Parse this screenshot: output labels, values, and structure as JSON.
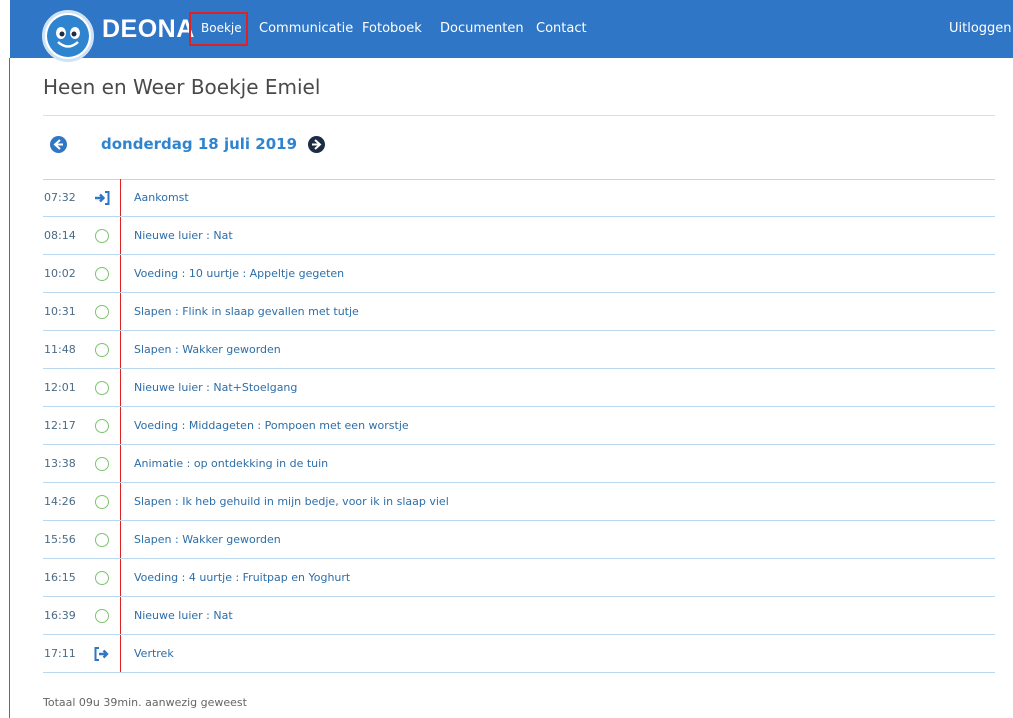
{
  "app": {
    "brand": "DEONA",
    "logo_icon": "smiley-face-icon"
  },
  "nav": {
    "items": [
      {
        "label": "Boekje"
      },
      {
        "label": "Communicatie"
      },
      {
        "label": "Fotoboek"
      },
      {
        "label": "Documenten"
      },
      {
        "label": "Contact"
      }
    ],
    "logout": "Uitloggen"
  },
  "page": {
    "title": "Heen en Weer Boekje Emiel",
    "date": "donderdag 18 juli 2019",
    "prev_icon": "arrow-left-icon",
    "next_icon": "arrow-right-icon"
  },
  "entries": [
    {
      "time": "07:32",
      "icon": "sign-in-icon",
      "text": "Aankomst"
    },
    {
      "time": "08:14",
      "icon": "circle-icon",
      "text": "Nieuwe luier : Nat"
    },
    {
      "time": "10:02",
      "icon": "circle-icon",
      "text": "Voeding : 10 uurtje : Appeltje gegeten"
    },
    {
      "time": "10:31",
      "icon": "circle-icon",
      "text": "Slapen : Flink in slaap gevallen met tutje"
    },
    {
      "time": "11:48",
      "icon": "circle-icon",
      "text": "Slapen : Wakker geworden"
    },
    {
      "time": "12:01",
      "icon": "circle-icon",
      "text": "Nieuwe luier : Nat+Stoelgang"
    },
    {
      "time": "12:17",
      "icon": "circle-icon",
      "text": "Voeding : Middageten : Pompoen met een worstje"
    },
    {
      "time": "13:38",
      "icon": "circle-icon",
      "text": "Animatie : op ontdekking in de tuin"
    },
    {
      "time": "14:26",
      "icon": "circle-icon",
      "text": "Slapen : Ik heb gehuild in mijn bedje, voor ik in slaap viel"
    },
    {
      "time": "15:56",
      "icon": "circle-icon",
      "text": "Slapen : Wakker geworden"
    },
    {
      "time": "16:15",
      "icon": "circle-icon",
      "text": "Voeding : 4 uurtje : Fruitpap en Yoghurt"
    },
    {
      "time": "16:39",
      "icon": "circle-icon",
      "text": "Nieuwe luier : Nat"
    },
    {
      "time": "17:11",
      "icon": "sign-out-icon",
      "text": "Vertrek"
    }
  ],
  "footer": {
    "total": "Totaal 09u 39min. aanwezig geweest"
  },
  "colors": {
    "nav_bg": "#2f76c6",
    "accent": "#2f84cf",
    "timeline_line": "#e02121",
    "circle": "#7cc46e"
  }
}
